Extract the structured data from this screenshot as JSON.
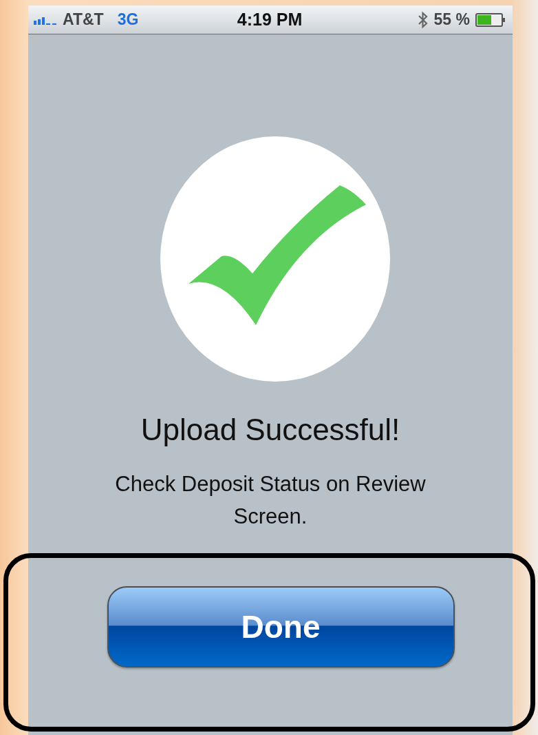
{
  "status_bar": {
    "carrier": "AT&T",
    "network": "3G",
    "time": "4:19 PM",
    "battery": "55 %"
  },
  "success": {
    "title": "Upload Successful!",
    "message": "Check Deposit Status on Review Screen."
  },
  "button": {
    "label": "Done"
  },
  "highlight": {
    "shown": true
  }
}
